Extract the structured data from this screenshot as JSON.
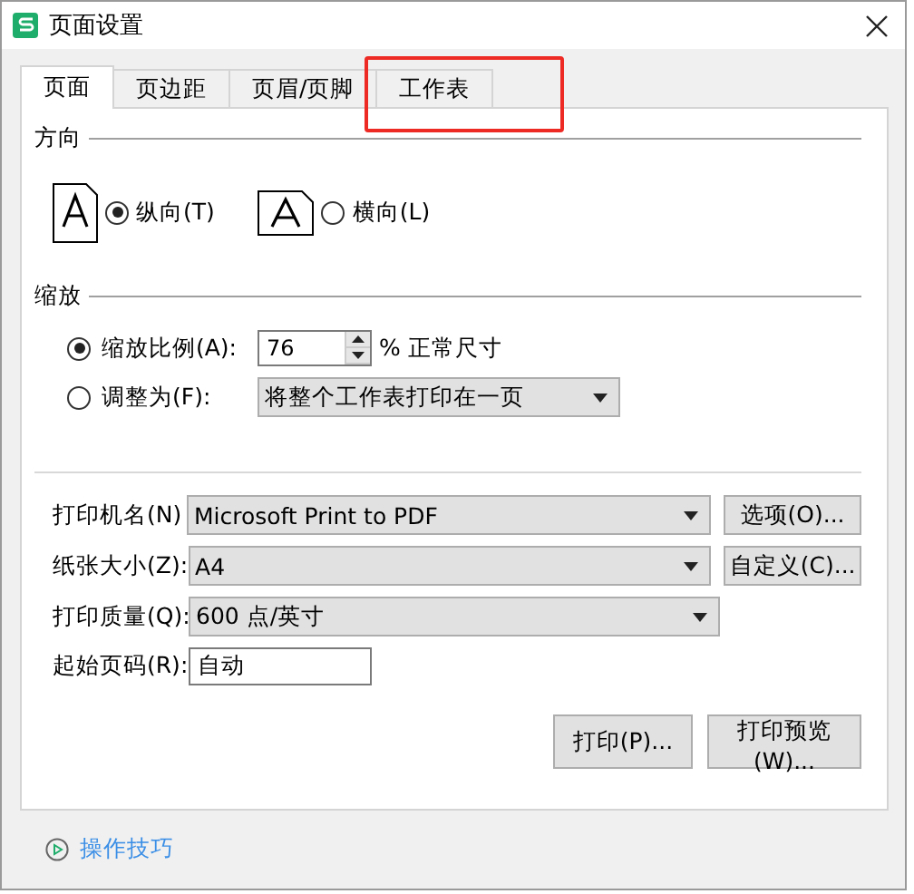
{
  "window": {
    "title": "页面设置"
  },
  "tabs": [
    {
      "label": "页面",
      "selected": true,
      "highlighted": false
    },
    {
      "label": "页边距",
      "selected": false,
      "highlighted": false
    },
    {
      "label": "页眉/页脚",
      "selected": false,
      "highlighted": false
    },
    {
      "label": "工作表",
      "selected": false,
      "highlighted": true
    }
  ],
  "orientation": {
    "title": "方向",
    "options": [
      {
        "label": "纵向(T)",
        "kind": "portrait",
        "selected": true
      },
      {
        "label": "横向(L)",
        "kind": "landscape",
        "selected": false
      }
    ]
  },
  "scaling": {
    "title": "缩放",
    "options": [
      {
        "label": "缩放比例(A):",
        "kind": "spinner",
        "selected": true,
        "value": "76",
        "suffix": "% 正常尺寸"
      },
      {
        "label": "调整为(F):",
        "kind": "dropdown",
        "selected": false,
        "value": "将整个工作表打印在一页"
      }
    ]
  },
  "printer_fields": [
    {
      "label": "打印机名(N)",
      "kind": "dropdown",
      "value": "Microsoft Print to PDF",
      "button": "选项(O)..."
    },
    {
      "label": "纸张大小(Z):",
      "kind": "dropdown",
      "value": "A4",
      "button": "自定义(C)..."
    },
    {
      "label": "打印质量(Q):",
      "kind": "dropdown",
      "value": "600 点/英寸"
    },
    {
      "label": "起始页码(R):",
      "kind": "text",
      "value": "自动"
    }
  ],
  "buttons": [
    "打印(P)...",
    "打印预览(W)..."
  ],
  "footer": {
    "link": "操作技巧"
  }
}
